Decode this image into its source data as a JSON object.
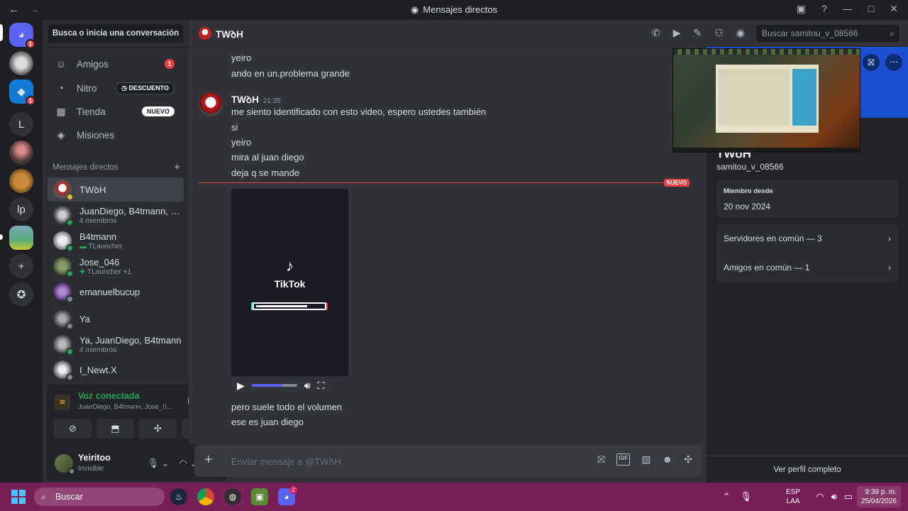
{
  "window": {
    "title": "Mensajes directos"
  },
  "sidebar": {
    "search_label": "Busca o inicia una conversación",
    "nav": [
      {
        "label": "Amigos",
        "badge": "1"
      },
      {
        "label": "Nitro",
        "badge": "DESCUENTO"
      },
      {
        "label": "Tienda",
        "badge": "NUEVO"
      },
      {
        "label": "Misiones",
        "badge": ""
      }
    ],
    "dm_header": "Mensajes directos",
    "dms": [
      {
        "name": "TWꝺH",
        "sub": ""
      },
      {
        "name": "JuanDiego, B4tmann, J...",
        "sub": "4 miembros"
      },
      {
        "name": "B4tmann",
        "sub": "TLauncher"
      },
      {
        "name": "Jose_046",
        "sub": "TLauncher +1"
      },
      {
        "name": "emanuelbucup",
        "sub": ""
      },
      {
        "name": "Ya",
        "sub": ""
      },
      {
        "name": "Ya, JuanDiego, B4tmann",
        "sub": "4 miembros"
      },
      {
        "name": "I_Newt.X",
        "sub": ""
      }
    ]
  },
  "voice": {
    "status": "Voz conectada",
    "members": "JuanDiego, B4tmann, Jose_0..."
  },
  "user": {
    "name": "Yeiritoo",
    "status": "Invisible"
  },
  "chat": {
    "title": "TWꝺH",
    "search_placeholder": "Buscar samitou_v_08566",
    "messages_top": [
      "yeiro",
      "ando en un.problema grande"
    ],
    "author": "TWꝺH",
    "time": "21:35",
    "messages_group": [
      "me siento identificado con esto video, espero ustedes también",
      "si",
      "yeiro",
      "mira al juan diego",
      "deja q se mande"
    ],
    "new_tag": "NUEVO",
    "video_brand": "TikTok",
    "video_progress": 0.68,
    "messages_after": [
      "pero suele todo el volumen",
      "ese es juan diego"
    ],
    "composer_placeholder": "Enviar mensaje a @TWꝺH"
  },
  "profile": {
    "name": "TWꝺH",
    "username": "samitou_v_08566",
    "member_since_label": "Miembro desde",
    "member_since": "20 nov 2024",
    "servers_common": "Servidores en común — 3",
    "friends_common": "Amigos en común — 1",
    "view_full": "Ver perfil completo"
  },
  "taskbar": {
    "search": "Buscar",
    "lang": "ESP",
    "lang2": "LAA",
    "time": "9:39 p. m.",
    "date": "25/04/2026",
    "discord_badge": "2"
  },
  "rail": {
    "badges": [
      "1",
      "1"
    ],
    "letters": [
      "L",
      "lp"
    ]
  },
  "colors": {
    "accent": "#5865f2",
    "online": "#23a55a",
    "danger": "#f23f43",
    "banner": "#1c4fd1",
    "taskbar": "#7a1e57"
  }
}
